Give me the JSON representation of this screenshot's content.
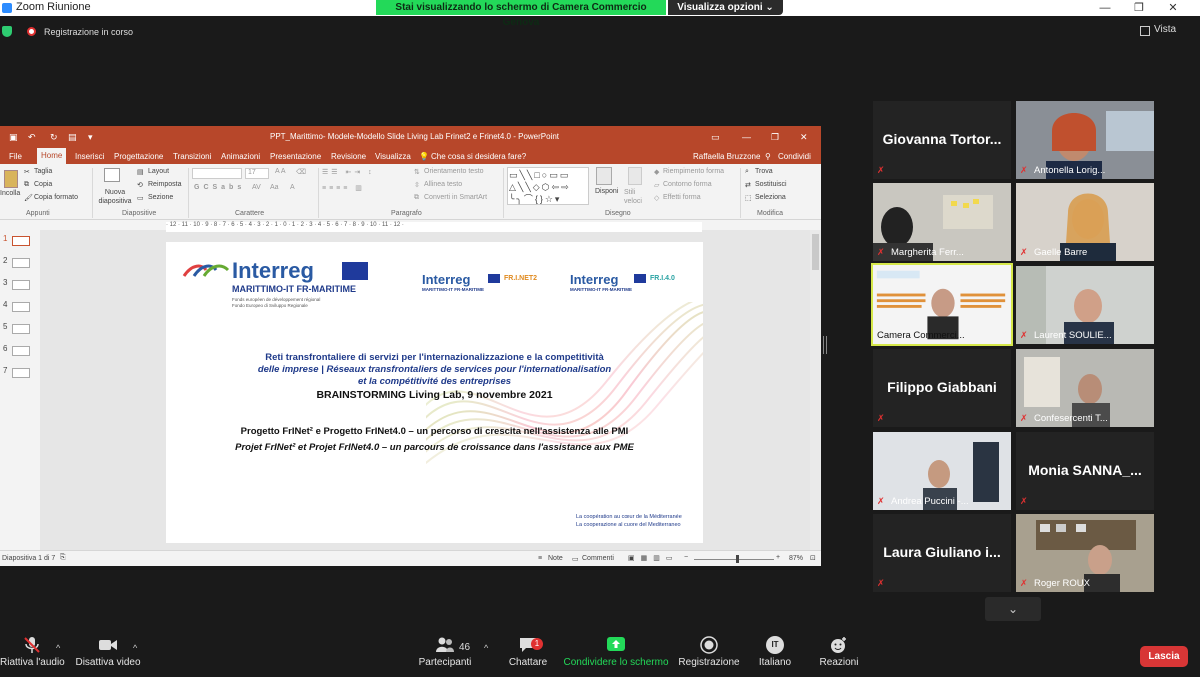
{
  "window": {
    "title": "Zoom Riunione",
    "controls": [
      "—",
      "❐",
      "✕"
    ]
  },
  "share_banner": {
    "text": "Stai visualizzando lo schermo di Camera Commercio Genova",
    "view_options": "Visualizza opzioni ⌄"
  },
  "status": {
    "recording": "Registrazione in corso",
    "view": "Vista"
  },
  "powerpoint": {
    "title": "PPT_Marittimo- Modele-Modello Slide Living Lab Frinet2 e Frinet4.0 - PowerPoint",
    "tabs": [
      "File",
      "Home",
      "Inserisci",
      "Progettazione",
      "Transizioni",
      "Animazioni",
      "Presentazione",
      "Revisione",
      "Visualizza"
    ],
    "tell_me": "Che cosa si desidera fare?",
    "user": "Raffaella Bruzzone",
    "share": "Condividi",
    "ribbon": {
      "clipboard": {
        "paste": "Incolla",
        "cut": "Taglia",
        "copy": "Copia",
        "format": "Copia formato",
        "group": "Appunti"
      },
      "slides": {
        "new": "Nuova diapositiva",
        "layout": "Layout",
        "reset": "Reimposta",
        "section": "Sezione",
        "group": "Diapositive"
      },
      "font": {
        "size": "17",
        "group": "Carattere"
      },
      "paragraph": {
        "orient": "Orientamento testo",
        "align": "Allinea testo",
        "smartart": "Converti in SmartArt",
        "group": "Paragrafo"
      },
      "drawing": {
        "arrange": "Disponi",
        "styles": "Stili veloci",
        "fill": "Riempimento forma",
        "outline": "Contorno forma",
        "effects": "Effetti forma",
        "group": "Disegno"
      },
      "editing": {
        "find": "Trova",
        "replace": "Sostituisci",
        "select": "Seleziona",
        "group": "Modifica"
      }
    },
    "ruler": "· 12 · 11 · 10 · 9 · 8 · 7 · 6 · 5 · 4 · 3 · 2 · 1 · 0 · 1 · 2 · 3 · 4 · 5 · 6 · 7 · 8 · 9 · 10 · 11 · 12 ·",
    "slide_numbers": [
      "1",
      "2",
      "3",
      "4",
      "5",
      "6",
      "7"
    ],
    "status_bar": {
      "slide": "Diapositiva 1 di 7",
      "notes": "Note",
      "comments": "Commenti",
      "zoom": "87%"
    }
  },
  "slide": {
    "logo_main": "Interreg",
    "logo_sub": "MARITTIMO-IT FR-MARITIME",
    "logo_fund1": "Fonds européen de développement régional",
    "logo_fund2": "Fondo Europeo di Sviluppo Regionale",
    "logo_small1": "Interreg",
    "logo_small1_sub": "MARITTIMO-IT FR-MARITIME",
    "logo_fri2": "FR.I.NET2",
    "logo_small2": "Interreg",
    "logo_small2_sub": "MARITTIMO-IT FR-MARITIME",
    "logo_fri4": "FR.I.4.0",
    "line1": "Reti transfrontaliere di servizi per l'internazionalizzazione e la competitività",
    "line2": "delle imprese | Réseaux transfrontaliers de services pour l'internationalisation",
    "line3": "et la compétitivité des entreprises",
    "line4": "BRAINSTORMING Living Lab, 9 novembre 2021",
    "line5": "Progetto FrINet² e Progetto FrINet4.0 – un percorso di crescita nell'assistenza alle PMI",
    "line6": "Projet FrINet² et Projet FrINet4.0 – un parcours de croissance dans l'assistance aux PME",
    "coop1": "La coopération au cœur de la Méditerranée",
    "coop2": "La cooperazione al cuore del Mediterraneo"
  },
  "participants": [
    {
      "name": "Giovanna Tortor...",
      "video": false
    },
    {
      "name": "Antonella Lorig...",
      "video": true
    },
    {
      "name": "Margherita Ferr...",
      "video": true
    },
    {
      "name": "Gaelle Barre",
      "video": true
    },
    {
      "name": "Camera Commerci...",
      "video": true,
      "active": true
    },
    {
      "name": "Laurent SOULIE...",
      "video": true
    },
    {
      "name": "Filippo Giabbani",
      "video": false
    },
    {
      "name": "Confesercenti T...",
      "video": true
    },
    {
      "name": "Andrea Puccini -...",
      "video": true
    },
    {
      "name": "Monia SANNA_...",
      "video": false
    },
    {
      "name": "Laura Giuliano i...",
      "video": false
    },
    {
      "name": "Roger ROUX",
      "video": true
    }
  ],
  "toolbar": {
    "audio": "Riattiva l'audio",
    "video": "Disattiva video",
    "participants": "Partecipanti",
    "participants_count": "46",
    "chat": "Chattare",
    "chat_badge": "1",
    "share": "Condividere lo schermo",
    "record": "Registrazione",
    "language": "Italiano",
    "language_code": "IT",
    "reactions": "Reazioni",
    "leave": "Lascia"
  },
  "colors": {
    "ppt_accent": "#b7472a",
    "share_green": "#23d959",
    "leave_red": "#d83636",
    "active_speaker": "#d6e84a"
  }
}
